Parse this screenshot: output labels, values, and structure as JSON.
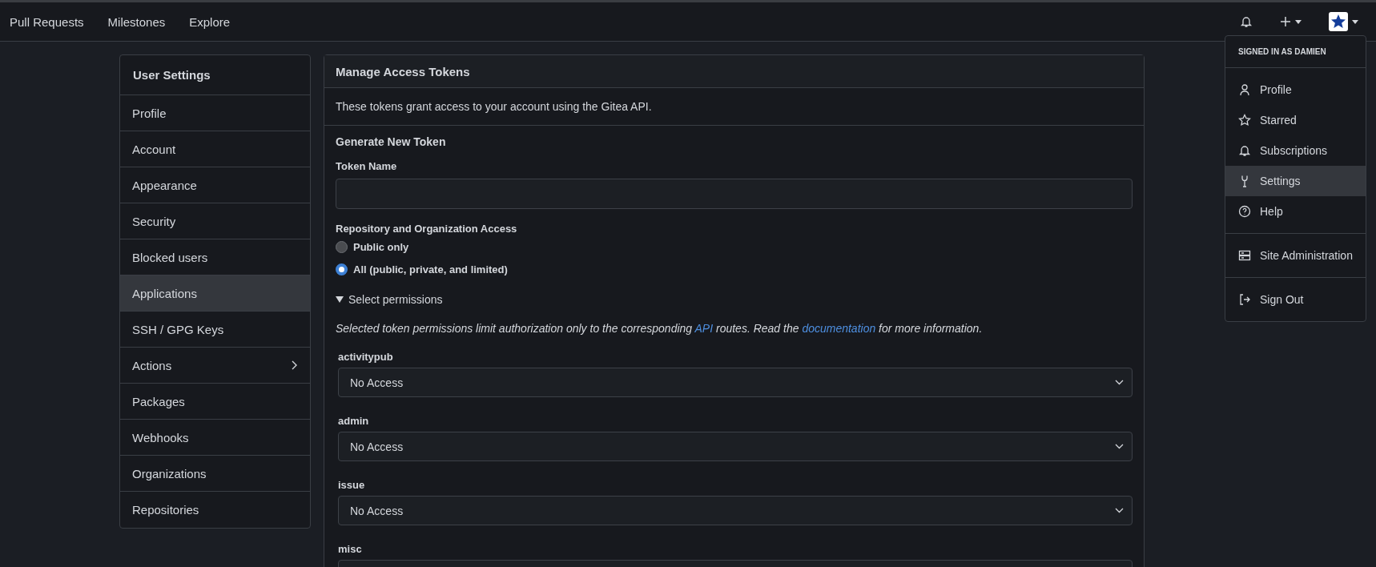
{
  "navbar": {
    "links": [
      {
        "label": "Pull Requests"
      },
      {
        "label": "Milestones"
      },
      {
        "label": "Explore"
      }
    ]
  },
  "user_menu": {
    "open": true,
    "header": "SIGNED IN AS DAMIEN",
    "groups": [
      [
        {
          "label": "Profile",
          "kind": "person",
          "selected": false
        },
        {
          "label": "Starred",
          "kind": "star",
          "selected": false
        },
        {
          "label": "Subscriptions",
          "kind": "bell",
          "selected": false
        },
        {
          "label": "Settings",
          "kind": "tools",
          "selected": true
        },
        {
          "label": "Help",
          "kind": "question",
          "selected": false
        }
      ],
      [
        {
          "label": "Site Administration",
          "kind": "server",
          "selected": false
        }
      ],
      [
        {
          "label": "Sign Out",
          "kind": "signout",
          "selected": false
        }
      ]
    ]
  },
  "sidebar": {
    "title": "User Settings",
    "items": [
      {
        "label": "Profile",
        "selected": false,
        "has_submenu": false
      },
      {
        "label": "Account",
        "selected": false,
        "has_submenu": false
      },
      {
        "label": "Appearance",
        "selected": false,
        "has_submenu": false
      },
      {
        "label": "Security",
        "selected": false,
        "has_submenu": false
      },
      {
        "label": "Blocked users",
        "selected": false,
        "has_submenu": false
      },
      {
        "label": "Applications",
        "selected": true,
        "has_submenu": false
      },
      {
        "label": "SSH / GPG Keys",
        "selected": false,
        "has_submenu": false
      },
      {
        "label": "Actions",
        "selected": false,
        "has_submenu": true
      },
      {
        "label": "Packages",
        "selected": false,
        "has_submenu": false
      },
      {
        "label": "Webhooks",
        "selected": false,
        "has_submenu": false
      },
      {
        "label": "Organizations",
        "selected": false,
        "has_submenu": false
      },
      {
        "label": "Repositories",
        "selected": false,
        "has_submenu": false
      }
    ]
  },
  "panel": {
    "title": "Manage Access Tokens",
    "description": "These tokens grant access to your account using the Gitea API.",
    "form": {
      "title": "Generate New Token",
      "token_name": {
        "label": "Token Name"
      },
      "access": {
        "label": "Repository and Organization Access",
        "options": [
          {
            "label": "Public only",
            "selected": false
          },
          {
            "label": "All (public, private, and limited)",
            "selected": true
          }
        ]
      },
      "permissions": {
        "summary": "Select permissions",
        "expanded": true,
        "note": [
          {
            "kind": "text",
            "text": "Selected token permissions limit authorization only to the corresponding "
          },
          {
            "kind": "link",
            "text": "API"
          },
          {
            "kind": "text",
            "text": " routes. Read the "
          },
          {
            "kind": "link",
            "text": "documentation"
          },
          {
            "kind": "text",
            "text": " for more information."
          }
        ],
        "scopes": [
          {
            "name": "activitypub",
            "value": "No Access"
          },
          {
            "name": "admin",
            "value": "No Access"
          },
          {
            "name": "issue",
            "value": "No Access"
          },
          {
            "name": "misc"
          }
        ]
      }
    }
  }
}
